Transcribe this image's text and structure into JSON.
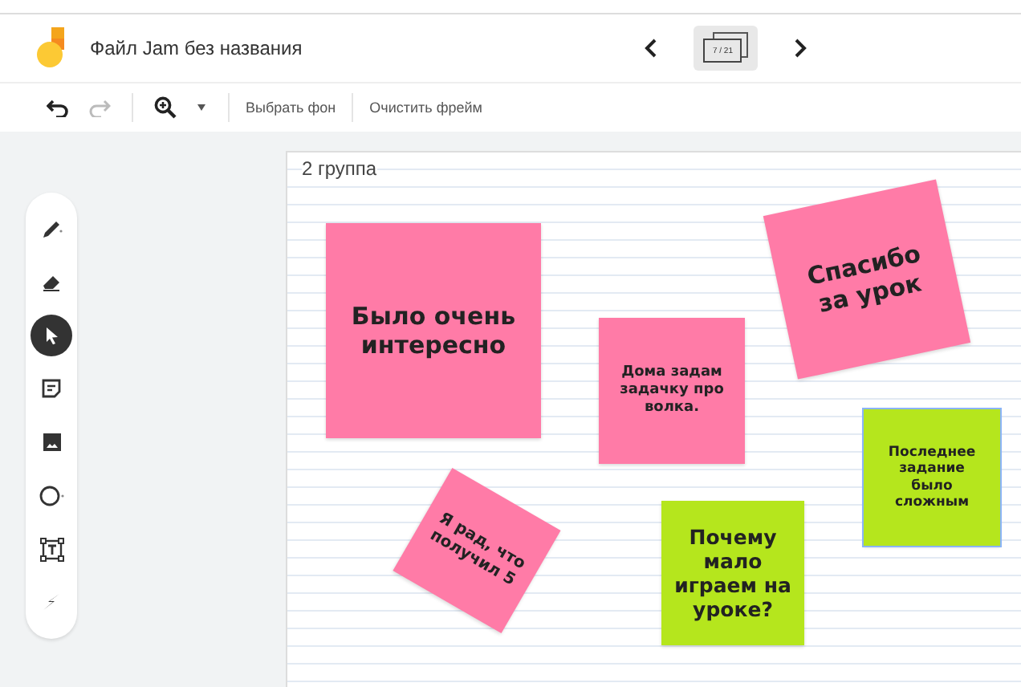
{
  "header": {
    "title": "Файл Jam без названия",
    "frame_counter": "7 / 21"
  },
  "toolbar": {
    "undo_disabled": false,
    "redo_disabled": true,
    "buttons": [
      "Выбрать фон",
      "Очистить фрейм"
    ]
  },
  "tools": [
    {
      "kind": "pen",
      "selected": false
    },
    {
      "kind": "eraser",
      "selected": false
    },
    {
      "kind": "select",
      "selected": true
    },
    {
      "kind": "note",
      "selected": false
    },
    {
      "kind": "image",
      "selected": false
    },
    {
      "kind": "circle",
      "selected": false
    },
    {
      "kind": "textbox",
      "selected": false
    },
    {
      "kind": "laser",
      "selected": false
    }
  ],
  "board": {
    "title": "2 группа",
    "notes": [
      {
        "text": "Было очень интересно",
        "color": "#ff7ba7",
        "selected": false
      },
      {
        "text": "Дома задам задачку про волка.",
        "color": "#ff7ba7",
        "selected": false
      },
      {
        "text": "Спасибо за урок",
        "color": "#ff7ba7",
        "selected": false
      },
      {
        "text": "Последнее задание было сложным",
        "color": "#b5e61d",
        "selected": true
      },
      {
        "text": "Я рад, что получил 5",
        "color": "#ff7ba7",
        "selected": false
      },
      {
        "text": "Почему мало играем на уроке?",
        "color": "#b5e61d",
        "selected": false
      }
    ]
  }
}
